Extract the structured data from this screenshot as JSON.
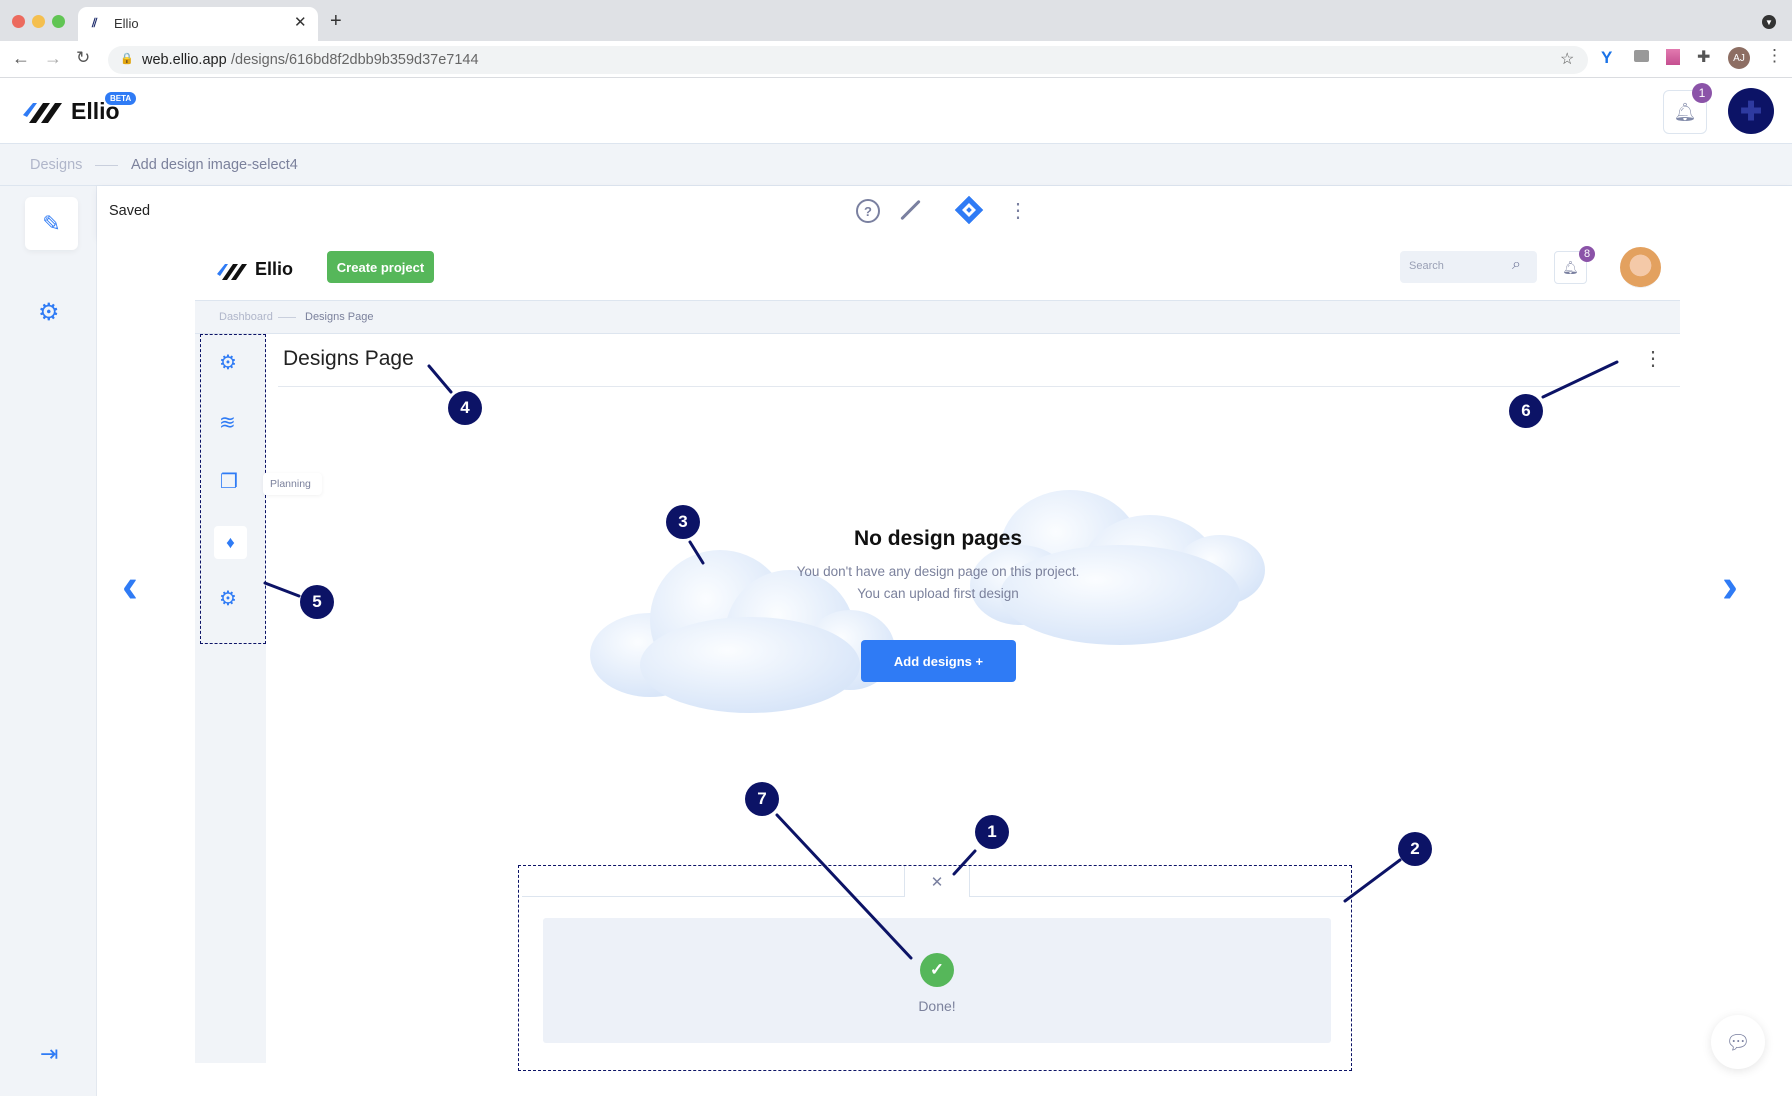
{
  "browser": {
    "tab_title": "Ellio",
    "url_host": "web.ellio.app",
    "url_path": "/designs/616bd8f2dbb9b359d37e7144",
    "profile_initials": "AJ"
  },
  "app": {
    "logo": "Ellio",
    "beta": "BETA",
    "notification_count": "1"
  },
  "breadcrumb": {
    "root": "Designs",
    "current": "Add design image-select4"
  },
  "toolbar": {
    "status": "Saved"
  },
  "preview": {
    "logo": "Ellio",
    "create_project": "Create project",
    "search_placeholder": "Search",
    "notification_count": "8",
    "breadcrumb": {
      "root": "Dashboard",
      "current": "Designs Page"
    },
    "page_title": "Designs Page",
    "tooltip": "Planning",
    "empty": {
      "title": "No design pages",
      "line1": "You don't have any design page on this project.",
      "line2": "You can upload first design",
      "button": "Add designs +"
    },
    "upload": {
      "status": "Done!"
    }
  },
  "callouts": [
    "1",
    "2",
    "3",
    "4",
    "5",
    "6",
    "7"
  ],
  "colors": {
    "accent": "#2f7bf5",
    "success": "#56b75a",
    "callout": "#0c1366",
    "badge": "#8b53a8"
  }
}
